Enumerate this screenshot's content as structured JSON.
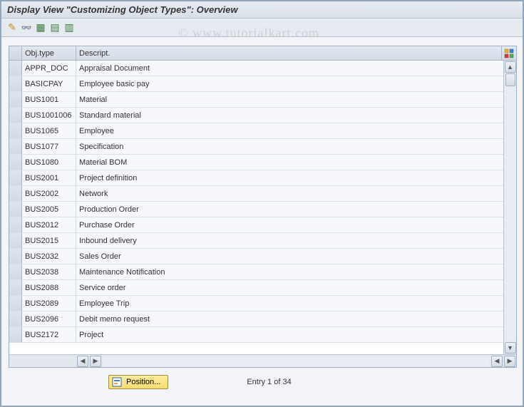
{
  "title": "Display View \"Customizing Object Types\": Overview",
  "toolbar": {
    "icons": [
      {
        "name": "toggle-change-icon",
        "glyph": "✎"
      },
      {
        "name": "glasses-icon",
        "glyph": "👓"
      },
      {
        "name": "select-all-icon",
        "glyph": "▦"
      },
      {
        "name": "select-block-icon",
        "glyph": "▤"
      },
      {
        "name": "deselect-all-icon",
        "glyph": "▥"
      }
    ]
  },
  "table": {
    "headers": {
      "obj_type": "Obj.type",
      "descript": "Descript."
    },
    "rows": [
      {
        "type": "APPR_DOC",
        "desc": "Appraisal Document"
      },
      {
        "type": "BASICPAY",
        "desc": "Employee basic pay"
      },
      {
        "type": "BUS1001",
        "desc": "Material"
      },
      {
        "type": "BUS1001006",
        "desc": "Standard material"
      },
      {
        "type": "BUS1065",
        "desc": "Employee"
      },
      {
        "type": "BUS1077",
        "desc": "Specification"
      },
      {
        "type": "BUS1080",
        "desc": "Material BOM"
      },
      {
        "type": "BUS2001",
        "desc": "Project definition"
      },
      {
        "type": "BUS2002",
        "desc": "Network"
      },
      {
        "type": "BUS2005",
        "desc": "Production Order"
      },
      {
        "type": "BUS2012",
        "desc": "Purchase Order"
      },
      {
        "type": "BUS2015",
        "desc": "Inbound delivery"
      },
      {
        "type": "BUS2032",
        "desc": "Sales Order"
      },
      {
        "type": "BUS2038",
        "desc": "Maintenance Notification"
      },
      {
        "type": "BUS2088",
        "desc": "Service order"
      },
      {
        "type": "BUS2089",
        "desc": "Employee Trip"
      },
      {
        "type": "BUS2096",
        "desc": "Debit memo request"
      },
      {
        "type": "BUS2172",
        "desc": "Project"
      }
    ]
  },
  "footer": {
    "position_label": "Position...",
    "entry_text": "Entry 1 of 34"
  },
  "watermark": "© www.tutorialkart.com"
}
